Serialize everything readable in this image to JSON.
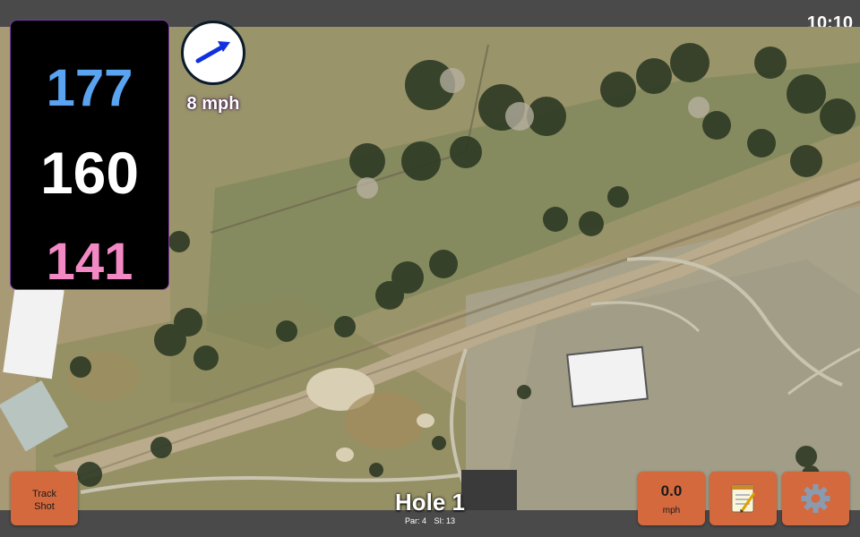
{
  "status": {
    "clock": "10:10"
  },
  "distances": {
    "back": "177",
    "center": "160",
    "front": "141"
  },
  "wind": {
    "speed_label": "8 mph",
    "direction_icon": "arrow-up-right-icon",
    "arrow_color": "#1030e0"
  },
  "hole": {
    "title": "Hole 1",
    "par_label": "Par: 4",
    "si_label": "SI: 13"
  },
  "buttons": {
    "track_shot": {
      "line1": "Track",
      "line2": "Shot"
    },
    "speed": {
      "value": "0.0",
      "unit": "mph"
    },
    "notes": {
      "icon": "notepad-icon"
    },
    "settings": {
      "icon": "gear-icon"
    }
  },
  "colors": {
    "back_distance": "#5aa3f0",
    "center_distance": "#ffffff",
    "front_distance": "#f288c4",
    "button_bg": "#d4693e",
    "bar_bg": "#4a4a4a"
  }
}
